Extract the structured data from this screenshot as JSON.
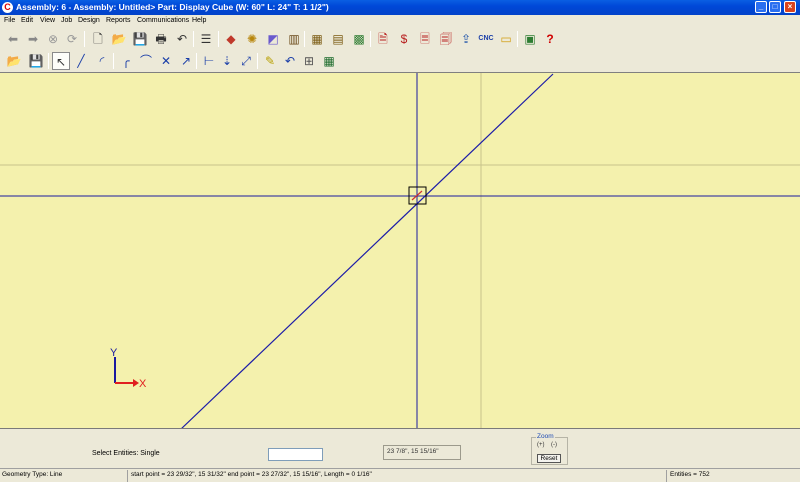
{
  "window": {
    "title": "Assembly:  6 - Assembly: Untitled> Part: Display Cube (W: 60\"  L: 24\"  T: 1 1/2\")",
    "logo_glyph": "C",
    "controls": {
      "minimize": "_",
      "maximize": "□",
      "close": "×"
    }
  },
  "menu": [
    "File",
    "Edit",
    "View",
    "Job",
    "Design",
    "Reports",
    "Communications",
    "Help"
  ],
  "toolbar1": {
    "icons": [
      {
        "name": "back-arrow-icon",
        "glyph": "⬅"
      },
      {
        "name": "forward-arrow-icon",
        "glyph": "➡"
      },
      {
        "name": "stop-icon",
        "glyph": "⊗"
      },
      {
        "name": "refresh-icon",
        "glyph": "⟳"
      },
      {
        "name": "new-document-icon",
        "glyph": "🗋"
      },
      {
        "name": "open-folder-icon",
        "glyph": "📂"
      },
      {
        "name": "save-icon",
        "glyph": "💾"
      },
      {
        "name": "print-icon",
        "glyph": "🖶"
      },
      {
        "name": "undo-icon",
        "glyph": "↶"
      },
      {
        "name": "settings-sliders-icon",
        "glyph": "☰"
      },
      {
        "name": "material-icon",
        "glyph": "◆"
      },
      {
        "name": "tools-icon",
        "glyph": "✺"
      },
      {
        "name": "drawing-icon",
        "glyph": "◩"
      },
      {
        "name": "cabinet-icon",
        "glyph": "▥"
      },
      {
        "name": "assembly-icon",
        "glyph": "▦"
      },
      {
        "name": "parts-list-icon",
        "glyph": "▤"
      },
      {
        "name": "nesting-icon",
        "glyph": "▩"
      },
      {
        "name": "report-icon",
        "glyph": "🗎"
      },
      {
        "name": "cost-report-icon",
        "glyph": "$"
      },
      {
        "name": "label-icon",
        "glyph": "🗏"
      },
      {
        "name": "cut-list-icon",
        "glyph": "🗐"
      },
      {
        "name": "export-icon",
        "glyph": "⇪"
      },
      {
        "name": "optimizer-icon",
        "glyph": "▭"
      },
      {
        "name": "monitor-icon",
        "glyph": "▣"
      },
      {
        "name": "help-icon",
        "glyph": "?"
      }
    ],
    "cnc_label": "CNC"
  },
  "toolbar2": {
    "icons": [
      {
        "name": "open-folder-icon",
        "glyph": "📂"
      },
      {
        "name": "save-icon",
        "glyph": "💾"
      },
      {
        "name": "pointer-select-icon",
        "glyph": "↖"
      },
      {
        "name": "line-tool-icon",
        "glyph": "╱"
      },
      {
        "name": "arc-tool-icon",
        "glyph": "◜"
      },
      {
        "name": "fillet-icon",
        "glyph": "╭"
      },
      {
        "name": "corner-arc-icon",
        "glyph": "⌒"
      },
      {
        "name": "trim-icon",
        "glyph": "✕"
      },
      {
        "name": "extend-icon",
        "glyph": "↗"
      },
      {
        "name": "dimension-icon",
        "glyph": "⊢"
      },
      {
        "name": "offset-icon",
        "glyph": "⇣"
      },
      {
        "name": "move-icon",
        "glyph": "⤢"
      },
      {
        "name": "erase-icon",
        "glyph": "✎"
      },
      {
        "name": "undo-icon",
        "glyph": "↶"
      },
      {
        "name": "grid-icon",
        "glyph": "⊞"
      },
      {
        "name": "snap-icon",
        "glyph": "▦"
      }
    ]
  },
  "canvas": {
    "background": "#f4f1ad",
    "axis_y_label": "Y",
    "axis_x_label": "X",
    "line_color": "#1c1ca8",
    "axis_color": "#1a1aa0",
    "x_axis_color": "#e02020"
  },
  "panel": {
    "select_label": "Select Entities:  Single",
    "coord_readout": "23 7/8\", 15 15/16\"",
    "zoom": {
      "label": "Zoom",
      "plus": "(+)",
      "minus": "(-)",
      "reset": "Reset"
    }
  },
  "status": {
    "geometry_type": "Geometry Type: Line",
    "details": "start point = 23 29/32\", 15 31/32\"  end point = 23 27/32\", 15 15/16\",  Length = 0 1/16\"",
    "entities": "Entities = 752"
  }
}
